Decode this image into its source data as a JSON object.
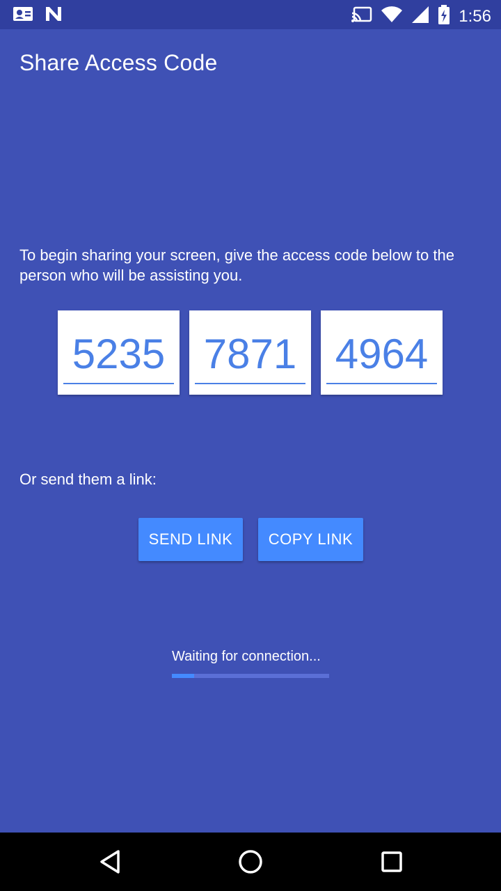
{
  "status_bar": {
    "time": "1:56",
    "icons": [
      "contact-card-icon",
      "n-app-icon",
      "cast-icon",
      "wifi-icon",
      "signal-icon",
      "battery-charging-icon"
    ]
  },
  "screen": {
    "title": "Share Access Code",
    "instructions": "To begin sharing your screen, give the access code below to the person who will be assisting you.",
    "access_code": [
      "5235",
      "7871",
      "4964"
    ],
    "link_label": "Or send them a link:",
    "send_link_label": "SEND LINK",
    "copy_link_label": "COPY LINK",
    "waiting_text": "Waiting for connection...",
    "progress_fraction": 0.14
  },
  "nav_bar": {
    "icons": [
      "back-icon",
      "home-icon",
      "recents-icon"
    ]
  },
  "colors": {
    "background": "#3f51b5",
    "status_bar": "#303f9f",
    "accent": "#448aff",
    "code_text": "#4a80e6"
  }
}
